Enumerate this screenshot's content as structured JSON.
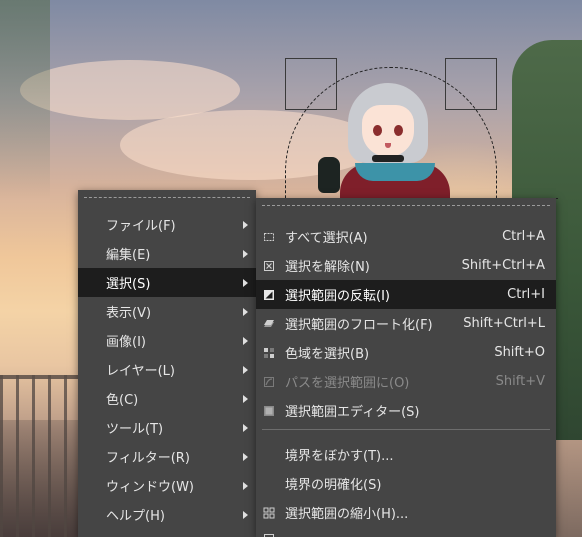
{
  "main_menu": {
    "items": [
      {
        "label": "ファイル(F)"
      },
      {
        "label": "編集(E)"
      },
      {
        "label": "選択(S)"
      },
      {
        "label": "表示(V)"
      },
      {
        "label": "画像(I)"
      },
      {
        "label": "レイヤー(L)"
      },
      {
        "label": "色(C)"
      },
      {
        "label": "ツール(T)"
      },
      {
        "label": "フィルター(R)"
      },
      {
        "label": "ウィンドウ(W)"
      },
      {
        "label": "ヘルプ(H)"
      }
    ]
  },
  "select_submenu": {
    "items": [
      {
        "label": "すべて選択(A)",
        "shortcut": "Ctrl+A",
        "icon": "select-all-icon"
      },
      {
        "label": "選択を解除(N)",
        "shortcut": "Shift+Ctrl+A",
        "icon": "select-none-icon"
      },
      {
        "label": "選択範囲の反転(I)",
        "shortcut": "Ctrl+I",
        "icon": "invert-selection-icon"
      },
      {
        "label": "選択範囲のフロート化(F)",
        "shortcut": "Shift+Ctrl+L",
        "icon": "float-selection-icon"
      },
      {
        "label": "色域を選択(B)",
        "shortcut": "Shift+O",
        "icon": "select-by-color-icon"
      },
      {
        "label": "パスを選択範囲に(O)",
        "shortcut": "Shift+V",
        "icon": "path-to-selection-icon"
      },
      {
        "label": "選択範囲エディター(S)",
        "shortcut": "",
        "icon": "selection-editor-icon"
      },
      {
        "label": "境界をぼかす(T)...",
        "shortcut": "",
        "icon": ""
      },
      {
        "label": "境界の明確化(S)",
        "shortcut": "",
        "icon": ""
      },
      {
        "label": "選択範囲の縮小(H)...",
        "shortcut": "",
        "icon": "shrink-selection-icon"
      }
    ]
  },
  "colors": {
    "menu_bg": "#454545",
    "menu_active_bg": "#1d1d1d",
    "menu_text": "#e6e6e6",
    "menu_disabled_text": "#8a8a8a"
  }
}
